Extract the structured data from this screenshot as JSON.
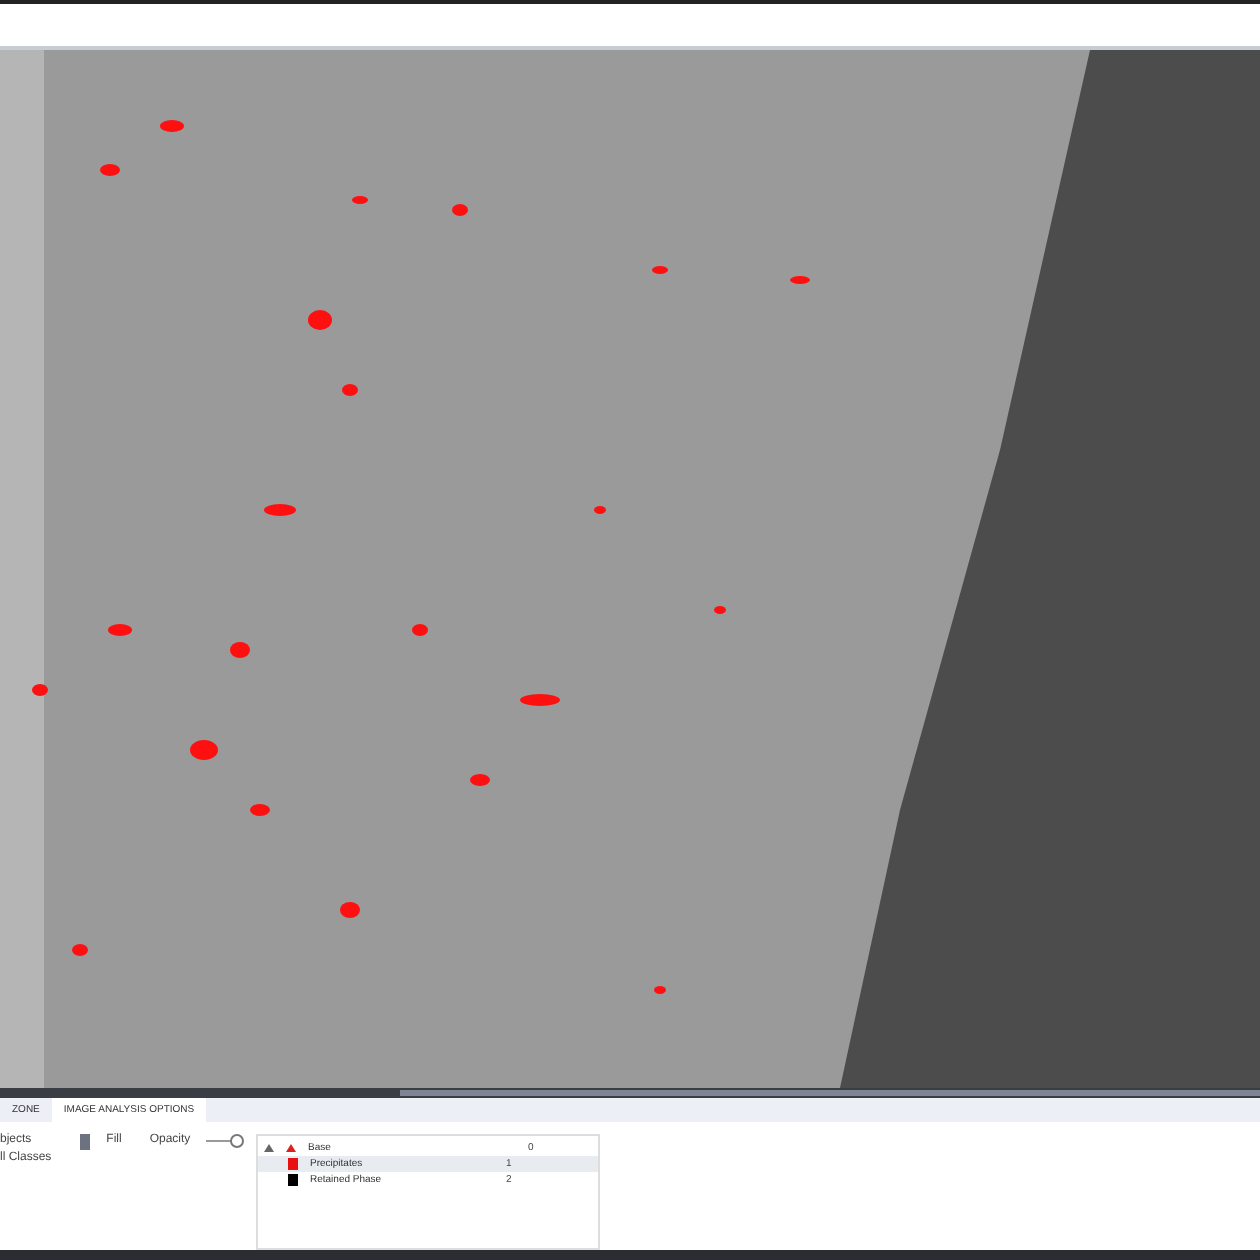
{
  "tabs": [
    {
      "label": "ZONE",
      "selected": false
    },
    {
      "label": "IMAGE ANALYSIS OPTIONS",
      "selected": true
    }
  ],
  "options": {
    "items": [
      "bjects",
      "ll Classes"
    ],
    "fill": {
      "label": "Fill",
      "checked": true
    },
    "opacity": {
      "label": "Opacity",
      "level": 1
    }
  },
  "classes": {
    "tree": [
      {
        "name": "Base",
        "count": "0",
        "color": "#e02020",
        "expanded": true,
        "selected": false,
        "children": [
          {
            "name": "Precipitates",
            "count": "1",
            "color": "#e81010",
            "selected": true
          },
          {
            "name": "Retained Phase",
            "count": "2",
            "color": "#000000",
            "selected": false
          }
        ]
      }
    ]
  }
}
